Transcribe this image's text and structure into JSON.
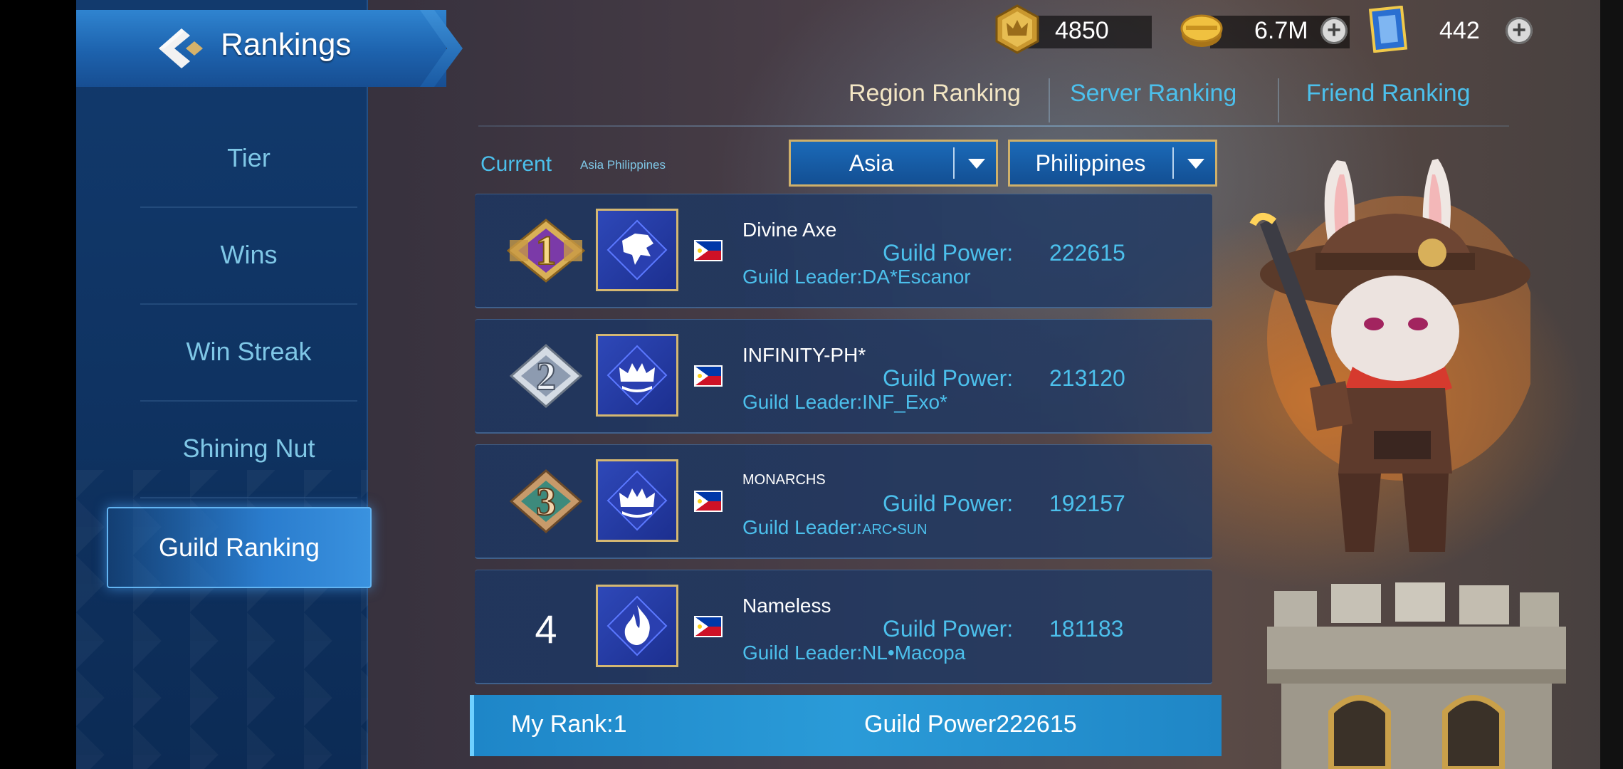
{
  "header": {
    "title": "Rankings"
  },
  "currencies": [
    {
      "icon": "crown-coin-icon",
      "value": "4850"
    },
    {
      "icon": "gold-coin-icon",
      "value": "6.7M"
    },
    {
      "icon": "ticket-icon",
      "value": "442"
    }
  ],
  "sidebar": {
    "items": [
      {
        "label": "Tier"
      },
      {
        "label": "Wins"
      },
      {
        "label": "Win Streak"
      },
      {
        "label": "Shining Nut"
      },
      {
        "label": "Guild Ranking",
        "active": true
      }
    ]
  },
  "tabs": [
    {
      "label": "Region Ranking",
      "active": true
    },
    {
      "label": "Server Ranking"
    },
    {
      "label": "Friend Ranking"
    }
  ],
  "filters": {
    "current_label": "Current",
    "current_value": "Asia Philippines",
    "region": "Asia",
    "country": "Philippines"
  },
  "power_label": "Guild Power:",
  "rows": [
    {
      "rank": "1",
      "name": "Divine Axe",
      "power": "222615",
      "leader_prefix": "Guild Leader:",
      "leader": "DA*Escanor",
      "emblem": "wolf-emblem-icon"
    },
    {
      "rank": "2",
      "name": "INFINITY-PH*",
      "power": "213120",
      "leader_prefix": "Guild Leader:",
      "leader": "INF_Exo*",
      "emblem": "crown-emblem-icon"
    },
    {
      "rank": "3",
      "name": "MONARCHS",
      "power": "192157",
      "leader_prefix": "Guild Leader:",
      "leader": "ARC•SUN",
      "emblem": "crown-emblem-icon"
    },
    {
      "rank": "4",
      "name": "Nameless",
      "power": "181183",
      "leader_prefix": "Guild Leader:",
      "leader": "NL•Macopa",
      "emblem": "flame-emblem-icon"
    }
  ],
  "my_rank": {
    "label": "My Rank:1",
    "power_label": "Guild Power",
    "power": "222615"
  },
  "colors": {
    "accent_cyan": "#4cc0ec",
    "gold_border": "#cfb06a",
    "sidebar_blue": "#0f3362"
  }
}
